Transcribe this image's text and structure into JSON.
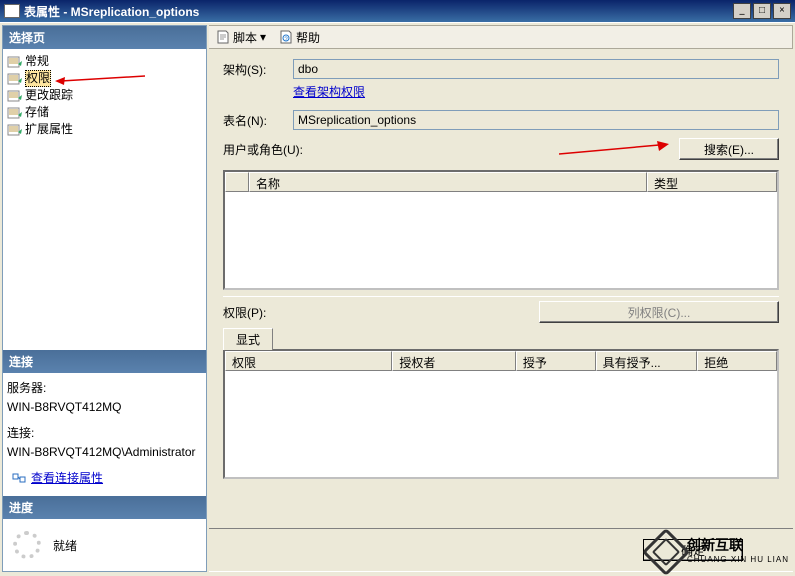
{
  "titlebar": {
    "title": "表属性 - MSreplication_options"
  },
  "sidebar": {
    "select_page_header": "选择页",
    "items": [
      {
        "label": "常规"
      },
      {
        "label": "权限"
      },
      {
        "label": "更改跟踪"
      },
      {
        "label": "存储"
      },
      {
        "label": "扩展属性"
      }
    ],
    "conn_header": "连接",
    "server_label": "服务器:",
    "server_value": "WIN-B8RVQT412MQ",
    "connection_label": "连接:",
    "connection_value": "WIN-B8RVQT412MQ\\Administrator",
    "view_conn_link": "查看连接属性",
    "progress_header": "进度",
    "progress_status": "就绪"
  },
  "toolbar": {
    "script_label": "脚本",
    "help_label": "帮助"
  },
  "form": {
    "schema_label": "架构(S):",
    "schema_value": "dbo",
    "view_schema_perm_link": "查看架构权限",
    "table_label": "表名(N):",
    "table_value": "MSreplication_options",
    "users_label": "用户或角色(U):",
    "search_btn": "搜索(E)..."
  },
  "grid": {
    "name_header": "名称",
    "type_header": "类型"
  },
  "perm": {
    "perm_label": "权限(P):",
    "col_perm_btn": "列权限(C)...",
    "tab_explicit": "显式",
    "headers": {
      "permission": "权限",
      "grantor": "授权者",
      "grant": "授予",
      "with_grant": "具有授予...",
      "deny": "拒绝"
    }
  },
  "buttons": {
    "ok": "确定"
  },
  "logo": {
    "main": "创新互联",
    "sub": "CHUANG XIN HU LIAN"
  }
}
